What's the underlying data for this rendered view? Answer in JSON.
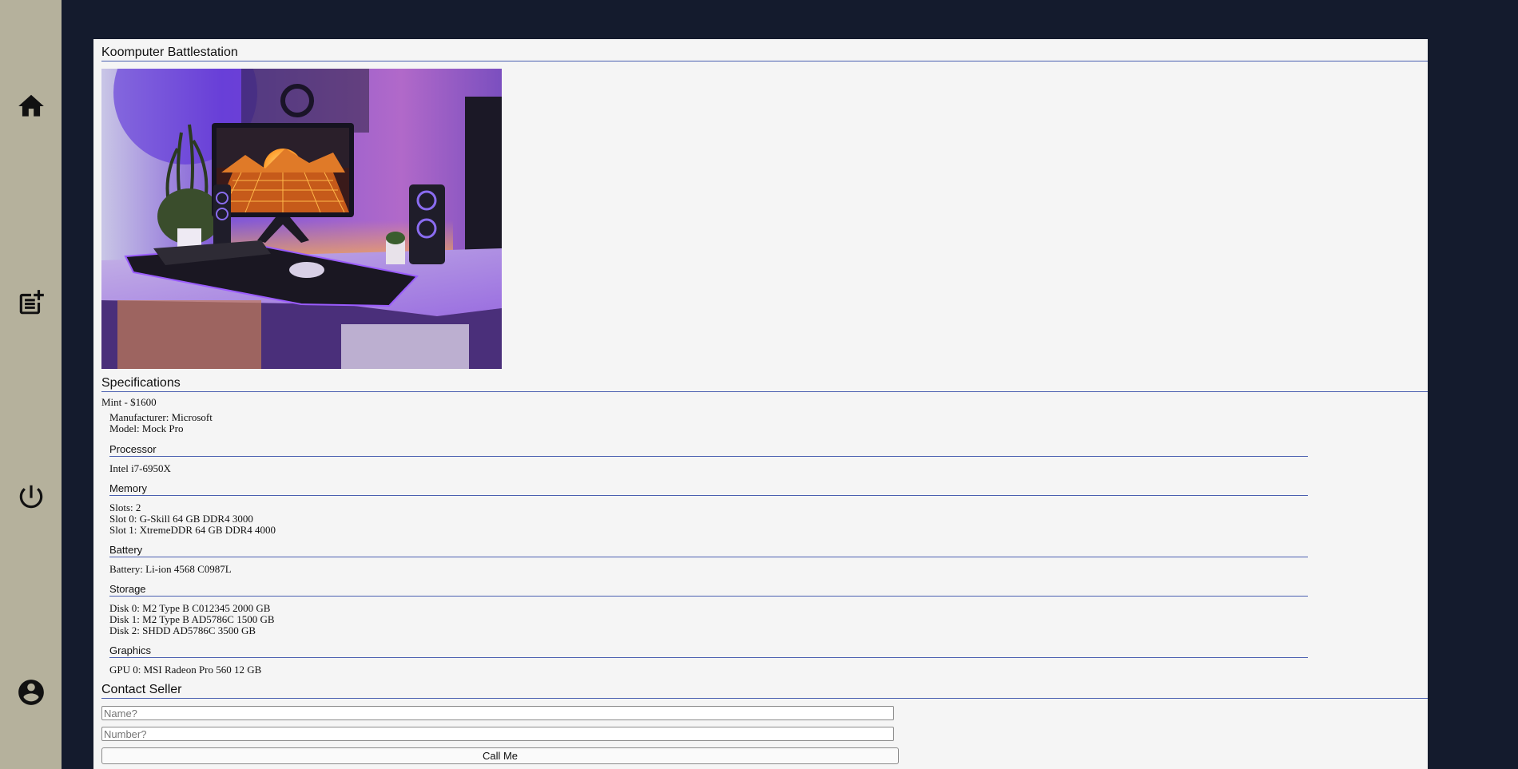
{
  "colors": {
    "page_background": "#141b2d",
    "sidebar": "#b5b19c",
    "panel": "#f5f5f5",
    "accent_line": "#4a5fb0"
  },
  "sidebar": {
    "items": [
      {
        "icon": "home-icon"
      },
      {
        "icon": "post-add-icon"
      },
      {
        "icon": "power-icon"
      },
      {
        "icon": "account-circle-icon"
      }
    ]
  },
  "listing": {
    "title": "Koomputer Battlestation",
    "image_alt": "Desk setup with curved monitor, speakers, keyboard and purple lighting"
  },
  "specifications": {
    "heading": "Specifications",
    "condition_price": "Mint - $1600",
    "manufacturer": "Manufacturer: Microsoft",
    "model": "Model: Mock Pro",
    "processor": {
      "heading": "Processor",
      "lines": [
        "Intel i7-6950X"
      ]
    },
    "memory": {
      "heading": "Memory",
      "lines": [
        "Slots: 2",
        "Slot 0: G-Skill 64 GB DDR4 3000",
        "Slot 1: XtremeDDR 64 GB DDR4 4000"
      ]
    },
    "battery": {
      "heading": "Battery",
      "lines": [
        "Battery: Li-ion 4568 C0987L"
      ]
    },
    "storage": {
      "heading": "Storage",
      "lines": [
        "Disk 0: M2 Type B C012345 2000 GB",
        "Disk 1: M2 Type B AD5786C 1500 GB",
        "Disk 2: SHDD AD5786C 3500 GB"
      ]
    },
    "graphics": {
      "heading": "Graphics",
      "lines": [
        "GPU 0: MSI Radeon Pro 560 12 GB"
      ]
    }
  },
  "contact": {
    "heading": "Contact Seller",
    "name_placeholder": "Name?",
    "number_placeholder": "Number?",
    "button_label": "Call Me"
  }
}
